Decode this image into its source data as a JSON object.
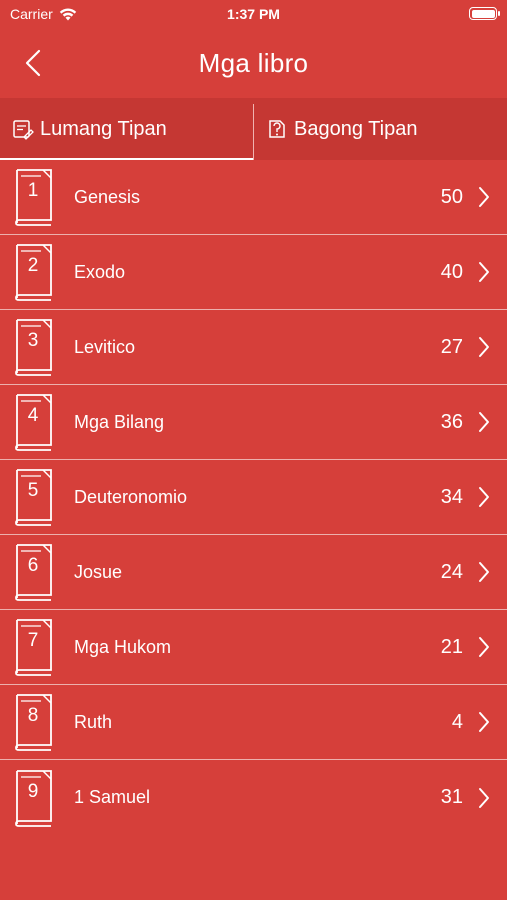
{
  "status": {
    "carrier": "Carrier",
    "time": "1:37 PM"
  },
  "header": {
    "title": "Mga libro"
  },
  "tabs": [
    {
      "label": "Lumang Tipan",
      "icon": "old-testament-icon",
      "active": true
    },
    {
      "label": "Bagong Tipan",
      "icon": "new-testament-icon",
      "active": false
    }
  ],
  "books": [
    {
      "number": "1",
      "name": "Genesis",
      "chapters": "50"
    },
    {
      "number": "2",
      "name": "Exodo",
      "chapters": "40"
    },
    {
      "number": "3",
      "name": "Levitico",
      "chapters": "27"
    },
    {
      "number": "4",
      "name": "Mga Bilang",
      "chapters": "36"
    },
    {
      "number": "5",
      "name": "Deuteronomio",
      "chapters": "34"
    },
    {
      "number": "6",
      "name": "Josue",
      "chapters": "24"
    },
    {
      "number": "7",
      "name": "Mga Hukom",
      "chapters": "21"
    },
    {
      "number": "8",
      "name": "Ruth",
      "chapters": "4"
    },
    {
      "number": "9",
      "name": "1 Samuel",
      "chapters": "31"
    }
  ],
  "colors": {
    "background": "#d63f3a",
    "tab_bar": "#c53733",
    "separator": "#ecb0ad",
    "foreground": "#ffffff"
  }
}
